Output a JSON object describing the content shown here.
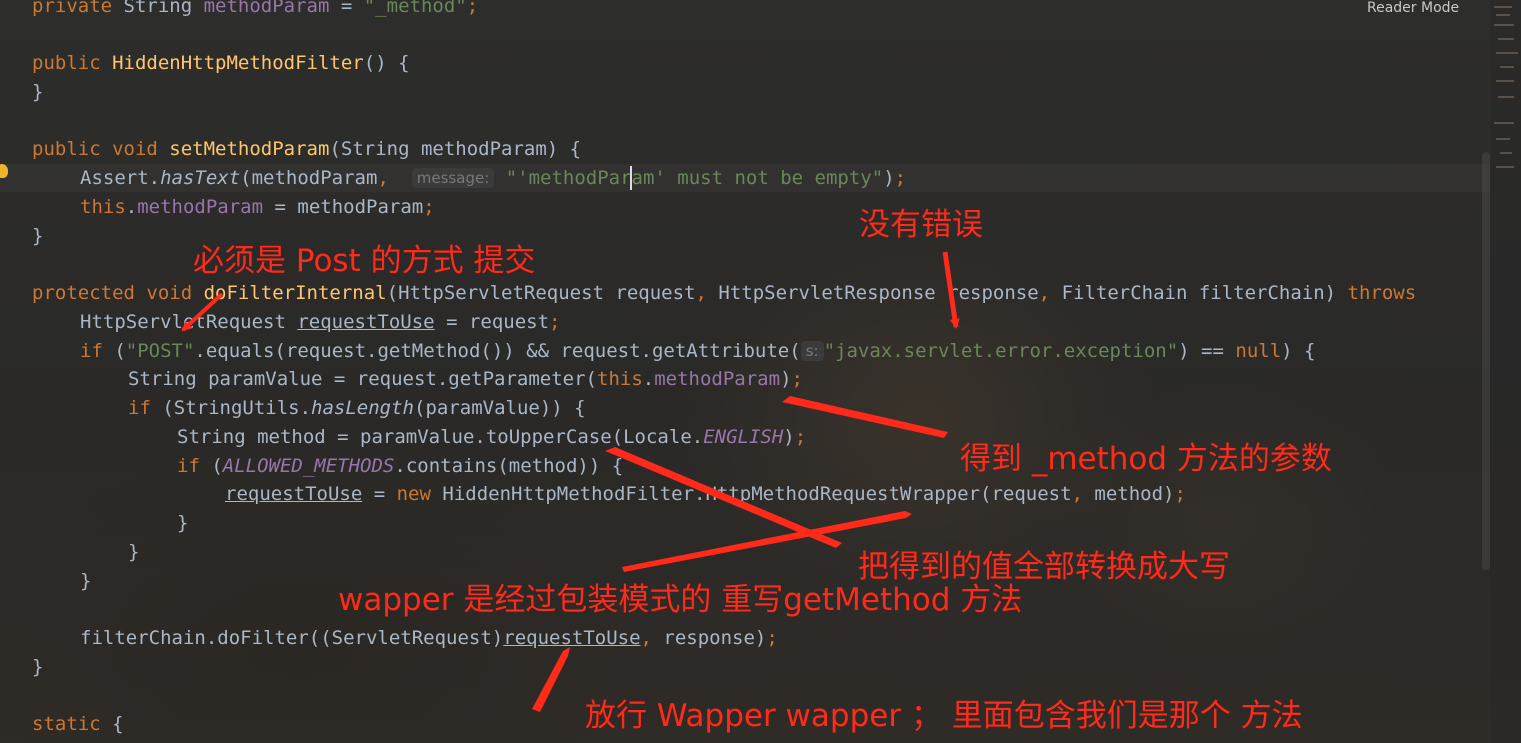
{
  "header": {
    "reader_mode": "Reader Mode"
  },
  "code": {
    "l1": {
      "kw": "private ",
      "type": "String ",
      "field": "methodParam",
      "mid": " = ",
      "str": "\"_method\"",
      "end": ";"
    },
    "l2": {
      "kw": "public ",
      "fn": "HiddenHttpMethodFilter",
      "rest": "() {"
    },
    "l3": {
      "text": "}"
    },
    "l4": {
      "kw": "public void ",
      "fn": "setMethodParam",
      "rest": "(String methodParam) {"
    },
    "l5": {
      "a": "Assert.",
      "it": "hasText",
      "b": "(methodParam",
      "comma": ", ",
      "hint": "message:",
      "str": "\"'methodParam' must not be empty\"",
      "c": ")",
      "semi": ";"
    },
    "l6": {
      "kw": "this",
      "dot": ".",
      "field": "methodParam",
      "rest": " = methodParam",
      "semi": ";"
    },
    "l7": {
      "text": "}"
    },
    "l8": {
      "kw": "protected void ",
      "fn": "doFilterInternal",
      "a": "(HttpServletRequest request",
      "c1": ", ",
      "b": "HttpServletResponse response",
      "c2": ", ",
      "c": "FilterChain filterChain) ",
      "throws": "throws"
    },
    "l9": {
      "a": "HttpServletRequest ",
      "u": "requestToUse",
      "b": " = request",
      "semi": ";"
    },
    "l10": {
      "kw": "if ",
      "a": "(",
      "str": "\"POST\"",
      "b": ".equals(request.getMethod()) && request.getAttribute(",
      "hint": "s:",
      "str2": "\"javax.servlet.error.exception\"",
      "c": ") == ",
      "kw2": "null",
      "d": ") {"
    },
    "l11": {
      "a": "String paramValue = request.getParameter(",
      "kw": "this",
      "dot": ".",
      "field": "methodParam",
      "b": ")",
      "semi": ";"
    },
    "l12": {
      "kw": "if ",
      "a": "(StringUtils.",
      "it": "hasLength",
      "b": "(paramValue)) {"
    },
    "l13": {
      "a": "String method = paramValue.toUpperCase(Locale.",
      "itf": "ENGLISH",
      "b": ")",
      "semi": ";"
    },
    "l14": {
      "kw": "if ",
      "a": "(",
      "itf": "ALLOWED_METHODS",
      "b": ".contains(method)) {"
    },
    "l15": {
      "u": "requestToUse",
      "a": " = ",
      "kw": "new ",
      "b": "HiddenHttpMethodFilter.HttpMethodRequestWrapper(request",
      "comma": ", ",
      "c": "method)",
      "semi": ";"
    },
    "l16": {
      "text": "}"
    },
    "l17": {
      "text": "}"
    },
    "l18": {
      "text": "}"
    },
    "l19": {
      "a": "filterChain.doFilter((ServletRequest)",
      "u": "requestToUse",
      "comma": ", ",
      "b": "response)",
      "semi": ";"
    },
    "l20": {
      "text": "}"
    },
    "l21": {
      "kw": "static ",
      "a": "{"
    }
  },
  "annotations": {
    "no_error": "没有错误",
    "must_post": "必须是 Post 的方式 提交",
    "get_param": "得到 _method 方法的参数",
    "to_upper": "把得到的值全部转换成大写",
    "wrapper": "wapper 是经过包装模式的 重写getMethod 方法",
    "pass_wrapper": "放行 Wapper  wapper ； 里面包含我们是那个 方法"
  },
  "colors": {
    "background": "#2b2b2b",
    "keyword": "#cc7832",
    "function": "#ffc66d",
    "string": "#6a8759",
    "field": "#9876aa",
    "text": "#a9b7c6",
    "annotation": "#ff2a1a"
  }
}
